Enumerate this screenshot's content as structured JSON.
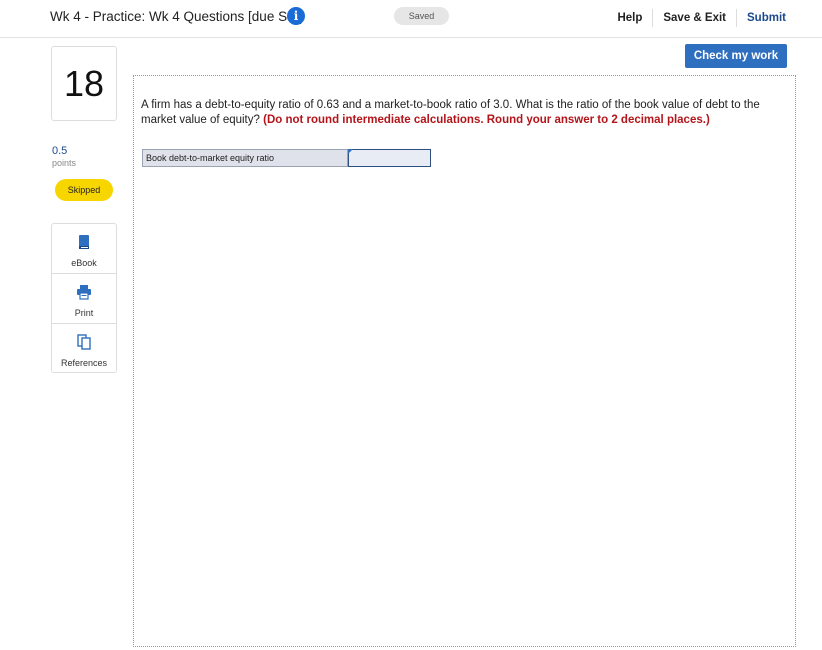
{
  "header": {
    "title": "Wk 4 - Practice: Wk 4 Questions [due Sat]",
    "info_icon": "info-icon",
    "saved_label": "Saved",
    "help_label": "Help",
    "save_exit_label": "Save & Exit",
    "submit_label": "Submit"
  },
  "question_meta": {
    "number": "18",
    "points_value": "0.5",
    "points_label": "points",
    "status": "Skipped"
  },
  "tools": [
    {
      "label": "eBook",
      "icon": "book-icon"
    },
    {
      "label": "Print",
      "icon": "print-icon"
    },
    {
      "label": "References",
      "icon": "references-icon"
    }
  ],
  "check_button_label": "Check my work",
  "question": {
    "text": "A firm has a debt-to-equity ratio of 0.63 and a market-to-book ratio of 3.0. What is the ratio of the book value of debt to the market value of equity?",
    "instruction": "(Do not round intermediate calculations. Round your answer to 2 decimal places.)"
  },
  "answer": {
    "label": "Book debt-to-market equity ratio",
    "value": ""
  },
  "colors": {
    "accent": "#2f6fbf",
    "instruction_red": "#b3151b",
    "skipped_yellow": "#f7d600"
  }
}
